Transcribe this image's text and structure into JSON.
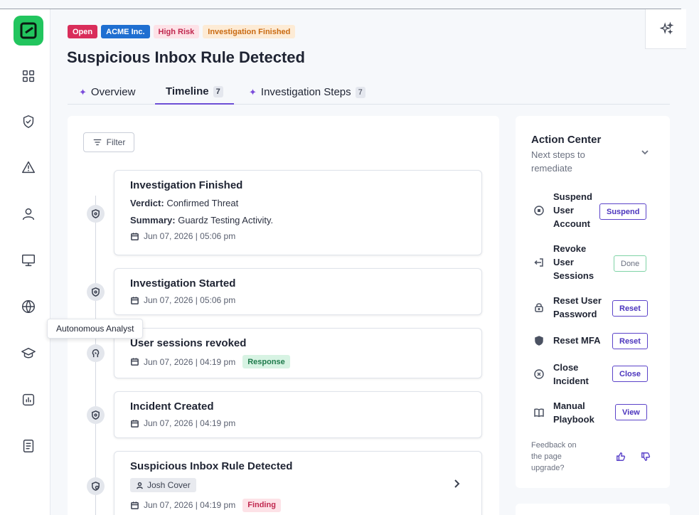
{
  "header": {
    "badges": {
      "status": "Open",
      "company": "ACME Inc.",
      "risk": "High Risk",
      "investigation": "Investigation Finished"
    },
    "title": "Suspicious Inbox Rule Detected"
  },
  "tabs": [
    {
      "label": "Overview",
      "count": ""
    },
    {
      "label": "Timeline",
      "count": "7"
    },
    {
      "label": "Investigation Steps",
      "count": "7"
    }
  ],
  "sidebar": {
    "tooltip": "Autonomous Analyst"
  },
  "timeline": {
    "filter_label": "Filter",
    "events": [
      {
        "title": "Investigation Finished",
        "verdict_label": "Verdict:",
        "verdict_value": "Confirmed Threat",
        "summary_label": "Summary:",
        "summary_value": "Guardz Testing Activity.",
        "date": "Jun 07, 2026 | 05:06 pm"
      },
      {
        "title": "Investigation Started",
        "date": "Jun 07, 2026 | 05:06 pm"
      },
      {
        "title": "User sessions revoked",
        "date": "Jun 07, 2026 | 04:19 pm",
        "tag": "Response"
      },
      {
        "title": "Incident Created",
        "date": "Jun 07, 2026 | 04:19 pm"
      },
      {
        "title": "Suspicious Inbox Rule Detected",
        "user": "Josh Cover",
        "date": "Jun 07, 2026 | 04:19 pm",
        "tag": "Finding"
      }
    ]
  },
  "action_center": {
    "title": "Action Center",
    "subtitle": "Next steps to remediate",
    "actions": [
      {
        "label": "Suspend User Account",
        "button": "Suspend"
      },
      {
        "label": "Revoke User Sessions",
        "button": "Done"
      },
      {
        "label": "Reset User Password",
        "button": "Reset"
      },
      {
        "label": "Reset MFA",
        "button": "Reset"
      },
      {
        "label": "Close Incident",
        "button": "Close"
      },
      {
        "label": "Manual Playbook",
        "button": "View"
      }
    ],
    "feedback": "Feedback on the page upgrade?"
  },
  "colors": {
    "accent": "#6d4fd6",
    "brand": "#22c55e",
    "open": "#d92d5a",
    "company": "#1f6fd1"
  }
}
